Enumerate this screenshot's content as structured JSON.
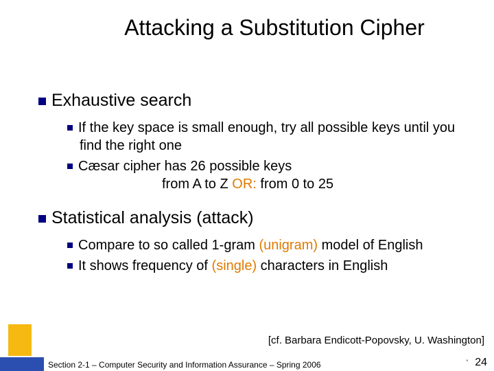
{
  "title": "Attacking a Substitution Cipher",
  "section1": {
    "heading": "Exhaustive search",
    "bullet1a": "If the key space is small enough, try all possible keys until you find the right one",
    "bullet1b": "Cæsar cipher has 26 possible keys",
    "bullet1b_line2_pre": "from A to Z  ",
    "bullet1b_line2_or": "OR:",
    "bullet1b_line2_post": " from 0 to 25"
  },
  "section2": {
    "heading": "Statistical analysis (attack)",
    "bullet2a_pre": "Compare to so called 1-gram ",
    "bullet2a_uni": "(unigram)",
    "bullet2a_post": " model of English",
    "bullet2b_pre": "It shows frequency of ",
    "bullet2b_single": "(single)",
    "bullet2b_post": " characters in English"
  },
  "citation": "[cf. Barbara Endicott-Popovsky, U. Washington]",
  "footer": "Section 2-1 – Computer Security and Information Assurance – Spring 2006",
  "pagenum": "24",
  "tick": "'"
}
